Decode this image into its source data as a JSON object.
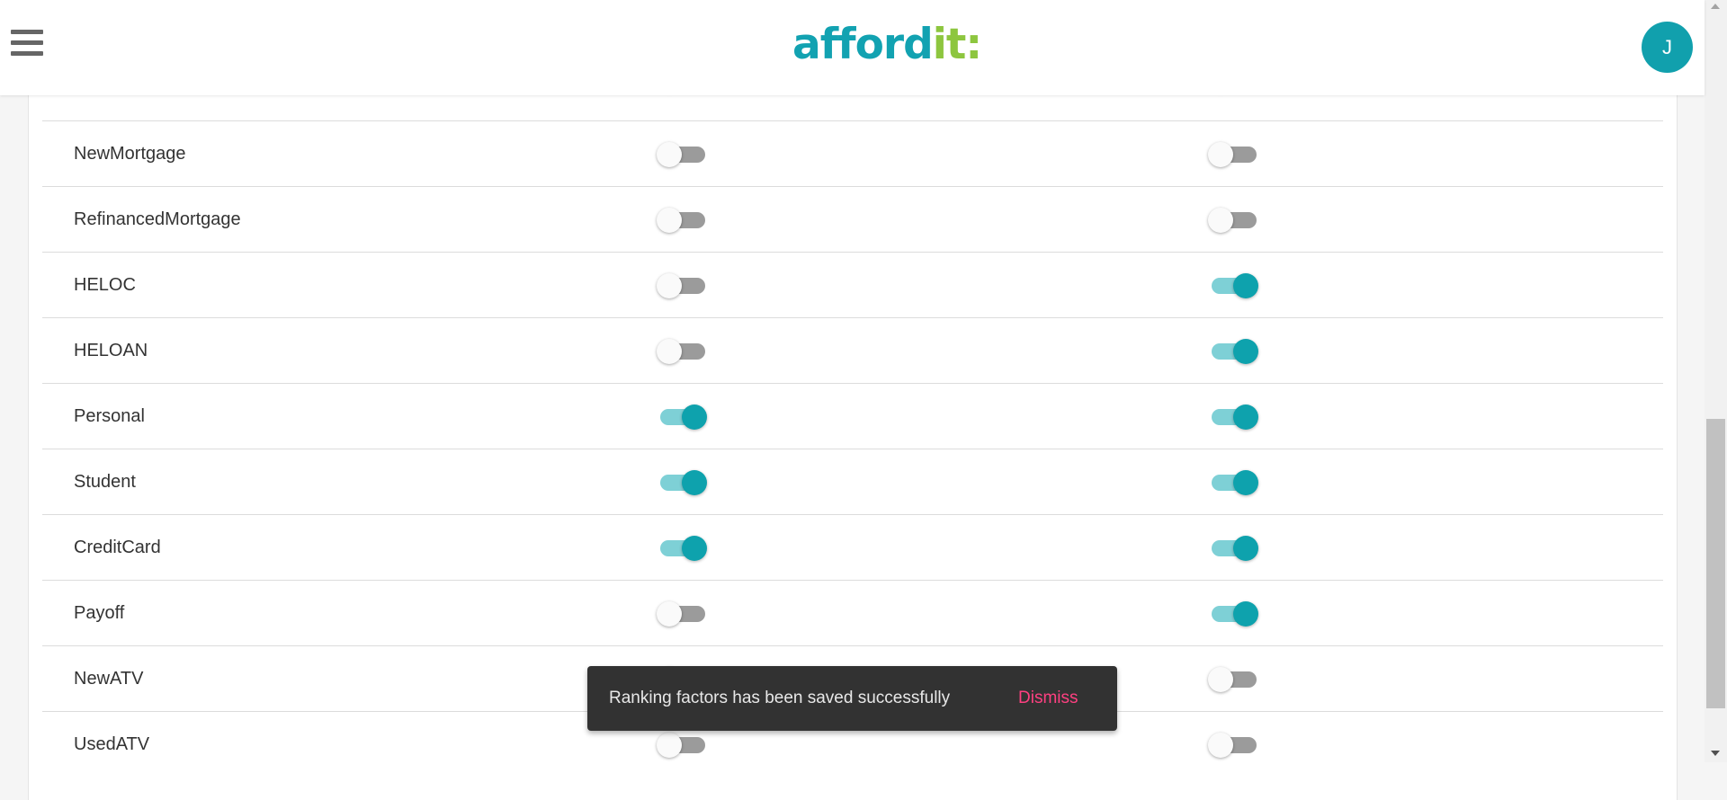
{
  "header": {
    "logo_main": "afford",
    "logo_accent": "it",
    "logo_mark": ":",
    "avatar_initial": "J"
  },
  "rows": [
    {
      "label": "NewMortgage",
      "col1_on": false,
      "col2_on": false
    },
    {
      "label": "RefinancedMortgage",
      "col1_on": false,
      "col2_on": false
    },
    {
      "label": "HELOC",
      "col1_on": false,
      "col2_on": true
    },
    {
      "label": "HELOAN",
      "col1_on": false,
      "col2_on": true
    },
    {
      "label": "Personal",
      "col1_on": true,
      "col2_on": true
    },
    {
      "label": "Student",
      "col1_on": true,
      "col2_on": true
    },
    {
      "label": "CreditCard",
      "col1_on": true,
      "col2_on": true
    },
    {
      "label": "Payoff",
      "col1_on": false,
      "col2_on": true
    },
    {
      "label": "NewATV",
      "col1_on": false,
      "col2_on": false
    },
    {
      "label": "UsedATV",
      "col1_on": false,
      "col2_on": false
    }
  ],
  "partial_row": {
    "col1_on": false,
    "col2_on": false
  },
  "snackbar": {
    "message": "Ranking factors has been saved successfully",
    "action": "Dismiss"
  },
  "colors": {
    "brand_teal": "#12a2b1",
    "brand_green": "#8dc63f",
    "toggle_on": "#0ea2ad",
    "toggle_off": "#9b9b9b",
    "dismiss": "#ff4081"
  }
}
